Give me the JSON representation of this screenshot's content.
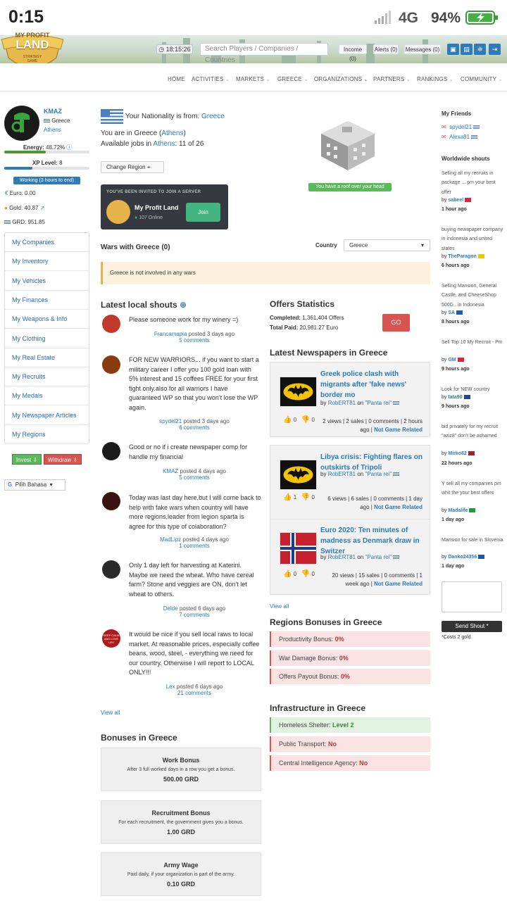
{
  "status_bar": {
    "time": "0:15",
    "network": "4G",
    "battery": "94%"
  },
  "header": {
    "logo": {
      "line1": "MY PROFIT",
      "line2": "LAND",
      "line3": "STRATEGY",
      "line4": "GAME"
    },
    "server_time": "18:15:26",
    "search_placeholder": "Search Players / Companies / Countries",
    "income": "Income (0)",
    "alerts": "Alerts (0)",
    "messages": "Messages (0)"
  },
  "nav": {
    "home": "HOME",
    "activities": "ACTIVITIES",
    "markets": "MARKETS",
    "greece": "GREECE",
    "organizations": "ORGANIZATIONS",
    "partners": "PARTNERS",
    "rankings": "RANKINGS",
    "community": "COMMUNITY"
  },
  "profile": {
    "name": "KMAZ",
    "country": "Greece",
    "city": "Athens",
    "energy_label": "Energy:",
    "energy_value": "48.72%",
    "energy_fraction": 0.4872,
    "xp_label": "XP Level:",
    "xp_value": "8",
    "xp_fraction": 0.33,
    "working": "Working (3 hours to end)",
    "euro": "Euro: 0.00",
    "gold": "Gold: 40.87",
    "grd": "GRD: 951.85"
  },
  "menu": [
    "My Companies",
    "My Inventory",
    "My Vehicles",
    "My Finances",
    "My Weapons & Info",
    "My Clothing",
    "My Real Estate",
    "My Recruits",
    "My Medals",
    "My Newspaper Articles",
    "My Regions"
  ],
  "invest": "Invest",
  "withdraw": "Withdraw",
  "language": "Pilih Bahasa",
  "nationality": {
    "prefix": "Your Nationality is from:",
    "country": "Greece",
    "location_prefix": "You are in Greece (",
    "location_city": "Athens",
    "location_suffix": ")",
    "jobs_prefix": "Available jobs in",
    "jobs_city": "Athens",
    "jobs_count": ": 11 of 26",
    "change_region": "Change Region"
  },
  "house": {
    "label": "You have a roof over your head"
  },
  "invite": {
    "heading": "YOU'VE BEEN INVITED TO JOIN A SERVER",
    "server": "My Profit Land",
    "online": "107 Online",
    "join": "Join"
  },
  "wars": {
    "title": "Wars with Greece (0)",
    "country_label": "Country",
    "country_value": "Greece",
    "notice": "Greece is not involved in any wars"
  },
  "shouts": {
    "title": "Latest local shouts",
    "items": [
      {
        "text": "Please someone work for my winery =)",
        "author": "Francamapia",
        "posted": "posted 3 days ago",
        "comments": "5 comments"
      },
      {
        "text": "FOR NEW WARRIORS... if you want to start a military career I offer you 100 gold loan with 5% interest and 15 coffees FREE for your first fight only.also for all warriors I have guaranteed WP so that you won't lose the WP again.",
        "author": "spydel21",
        "posted": "posted 3 days ago",
        "comments": "6 comments"
      },
      {
        "text": "Good or no if i create newspaper comp for handle my financial",
        "author": "KMAZ",
        "posted": "posted 4 days ago",
        "comments": "5 comments"
      },
      {
        "text": "Today was last day here,but I will come back to help with fake wars when country will have more regions,leader from legion sparta is agree for this type of colaboration?",
        "author": "MadLipz",
        "posted": "posted 4 days ago",
        "comments": "1 comments"
      },
      {
        "text": "Only 1 day left for harvesting at Katerini. Maybe we need the wheat. Who have cereal farm? Stone and veggies are ON, don't let wheat to others.",
        "author": "Delde",
        "posted": "posted 6 days ago",
        "comments": "7 comments"
      },
      {
        "text": "It would be nice if you sell local raws to local market. At reasonable prices, especially coffee beans, wood, steel, - everything we need for our country. Otherwise I will report to LOCAL ONLY!!!",
        "author": "Lex",
        "posted": "posted 6 days ago",
        "comments": "21 comments"
      }
    ],
    "view_all": "View all",
    "avatar_text": "KEEP CALM AND LOVE LEX"
  },
  "bonuses": {
    "title": "Bonuses in Greece",
    "items": [
      {
        "title": "Work Bonus",
        "desc": "After 3 full worked days in a row you get a bonus.",
        "value": "500.00 GRD"
      },
      {
        "title": "Recruitment Bonus",
        "desc": "For each recruitment, the government gives you a bonus.",
        "value": "1.00 GRD"
      },
      {
        "title": "Army Wage",
        "desc": "Paid daily, if your organization is part of the army.",
        "value": "0.10 GRD"
      }
    ]
  },
  "offers": {
    "title": "Offers Statistics",
    "completed_label": "Completed:",
    "completed_value": "1,361,404 Offers",
    "paid_label": "Total Paid:",
    "paid_value": "20,981.27 Euro",
    "go": "GO"
  },
  "newspapers": {
    "title": "Latest Newspapers in Greece",
    "items": [
      {
        "title": "Greek police clash with migrants after 'fake news' border mo",
        "by": "by",
        "author": "RobERT81",
        "on": "on",
        "paper": "\"Panta rei\"",
        "likes": "0",
        "dislikes": "0",
        "meta": "2 views | 2 sales | 0 comments | 2 hours ago |",
        "tag": "Not Game Related"
      },
      {
        "title": "Libya crisis: Fighting flares on outskirts of Tripoli",
        "by": "by",
        "author": "RobERT81",
        "on": "on",
        "paper": "\"Panta rei\"",
        "likes": "1",
        "dislikes": "0",
        "meta": "6 views | 6 sales | 0 comments | 1 day ago |",
        "tag": "Not Game Related"
      },
      {
        "title": "Euro 2020: Ten minutes of madness as Denmark draw in Switzer",
        "by": "by",
        "author": "RobERT81",
        "on": "on",
        "paper": "\"Panta rei\"",
        "likes": "0",
        "dislikes": "0",
        "meta": "20 views | 15 sales | 0 comments | 1 week ago |",
        "tag": "Not Game Related"
      }
    ],
    "view_all": "View all"
  },
  "regions": {
    "title": "Regions Bonuses in Greece",
    "items": [
      {
        "label": "Productivity Bonus:",
        "value": "0%"
      },
      {
        "label": "War Damage Bonus:",
        "value": "0%"
      },
      {
        "label": "Offers Payout Bonus:",
        "value": "0%"
      }
    ]
  },
  "infrastructure": {
    "title": "Infrastructure in Greece",
    "items": [
      {
        "label": "Homeless Shelter:",
        "value": "Level 2"
      },
      {
        "label": "Public Transport:",
        "value": "No"
      },
      {
        "label": "Central Intelligence Agency:",
        "value": "No"
      }
    ]
  },
  "friends": {
    "title": "My Friends",
    "items": [
      "spydel21",
      "Alexa81"
    ]
  },
  "worldwide": {
    "title": "Worldwide shouts",
    "items": [
      {
        "text": "Selling all my recruits in package ... pm your best offer",
        "by": "by",
        "author": "sabeel",
        "time": "1 hour ago"
      },
      {
        "text": "buying newspaper company in indonesia and united states",
        "by": "by",
        "author": "TheParagon",
        "time": "6 hours ago"
      },
      {
        "text": "Selling Mansion, General Castle, and CheeseShop 500G.. in Indonesia",
        "by": "by",
        "author": "SA",
        "time": "8 hours ago"
      },
      {
        "text": "Sell Top 10 My Recruit - Pm",
        "by": "by",
        "author": "GM",
        "time": "9 hours ago"
      },
      {
        "text": "Look for NEW country",
        "by": "by",
        "author": "tata90",
        "time": "9 hours ago"
      },
      {
        "text": "bid privately for my recruit \"aziz8\" don't be ashamed",
        "by": "by",
        "author": "Mirko82",
        "time": "22 hours ago"
      },
      {
        "text": "Y sell all my companies pm whit the your best offers",
        "by": "by",
        "author": "Madalife",
        "time": "1 day ago"
      },
      {
        "text": "Mansion for sale in Slovenia",
        "by": "by",
        "author": "Danko24356",
        "time": "1 day ago"
      }
    ],
    "send": "Send Shout *",
    "cost": "*Costs 2 gold"
  },
  "colors": {
    "link": "#2a7ab8",
    "accent": "#2e7bb8",
    "green": "#4a9b2f",
    "red": "#d9534f"
  }
}
